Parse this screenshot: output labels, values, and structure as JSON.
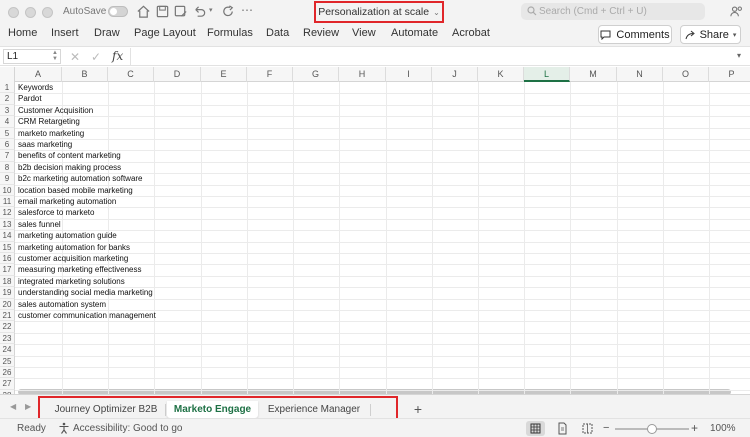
{
  "titlebar": {
    "autosave_label": "AutoSave",
    "document_title": "Personalization at scale",
    "search_placeholder": "Search (Cmd + Ctrl + U)"
  },
  "ribbon": {
    "tabs": [
      "Home",
      "Insert",
      "Draw",
      "Page Layout",
      "Formulas",
      "Data",
      "Review",
      "View",
      "Automate",
      "Acrobat"
    ],
    "comments_label": "Comments",
    "share_label": "Share"
  },
  "formula_bar": {
    "name_box": "L1",
    "fx_label": "fx",
    "formula": ""
  },
  "grid": {
    "columns": [
      "A",
      "B",
      "C",
      "D",
      "E",
      "F",
      "G",
      "H",
      "I",
      "J",
      "K",
      "L",
      "M",
      "N",
      "O",
      "P"
    ],
    "selected_column": "L",
    "row_numbers": [
      "1",
      "2",
      "3",
      "4",
      "5",
      "6",
      "7",
      "8",
      "9",
      "10",
      "11",
      "12",
      "13",
      "14",
      "15",
      "16",
      "17",
      "18",
      "19",
      "20",
      "21",
      "22",
      "23",
      "24",
      "25",
      "26",
      "27",
      "28"
    ],
    "column_a": [
      "Keywords",
      "Pardot",
      "Customer Acquisition",
      "CRM Retargeting",
      "marketo marketing",
      "saas marketing",
      "benefits of content marketing",
      "b2b decision making process",
      "b2c marketing automation software",
      "location based mobile marketing",
      "email marketing automation",
      "salesforce to marketo",
      "sales funnel",
      "marketing automation guide",
      "marketing automation for banks",
      "customer acquisition marketing",
      "measuring marketing effectiveness",
      "integrated marketing solutions",
      "understanding social media marketing",
      "sales automation system",
      "customer communication management"
    ]
  },
  "sheets": {
    "tabs": [
      "Journey Optimizer B2B",
      "Marketo Engage",
      "Experience Manager"
    ],
    "active": "Marketo Engage",
    "add_label": "+"
  },
  "status": {
    "ready": "Ready",
    "accessibility": "Accessibility: Good to go",
    "zoom": "100%",
    "zoom_fraction": 0.5
  },
  "colors": {
    "accent_green": "#1e7145",
    "highlight_red": "#e0262a"
  }
}
